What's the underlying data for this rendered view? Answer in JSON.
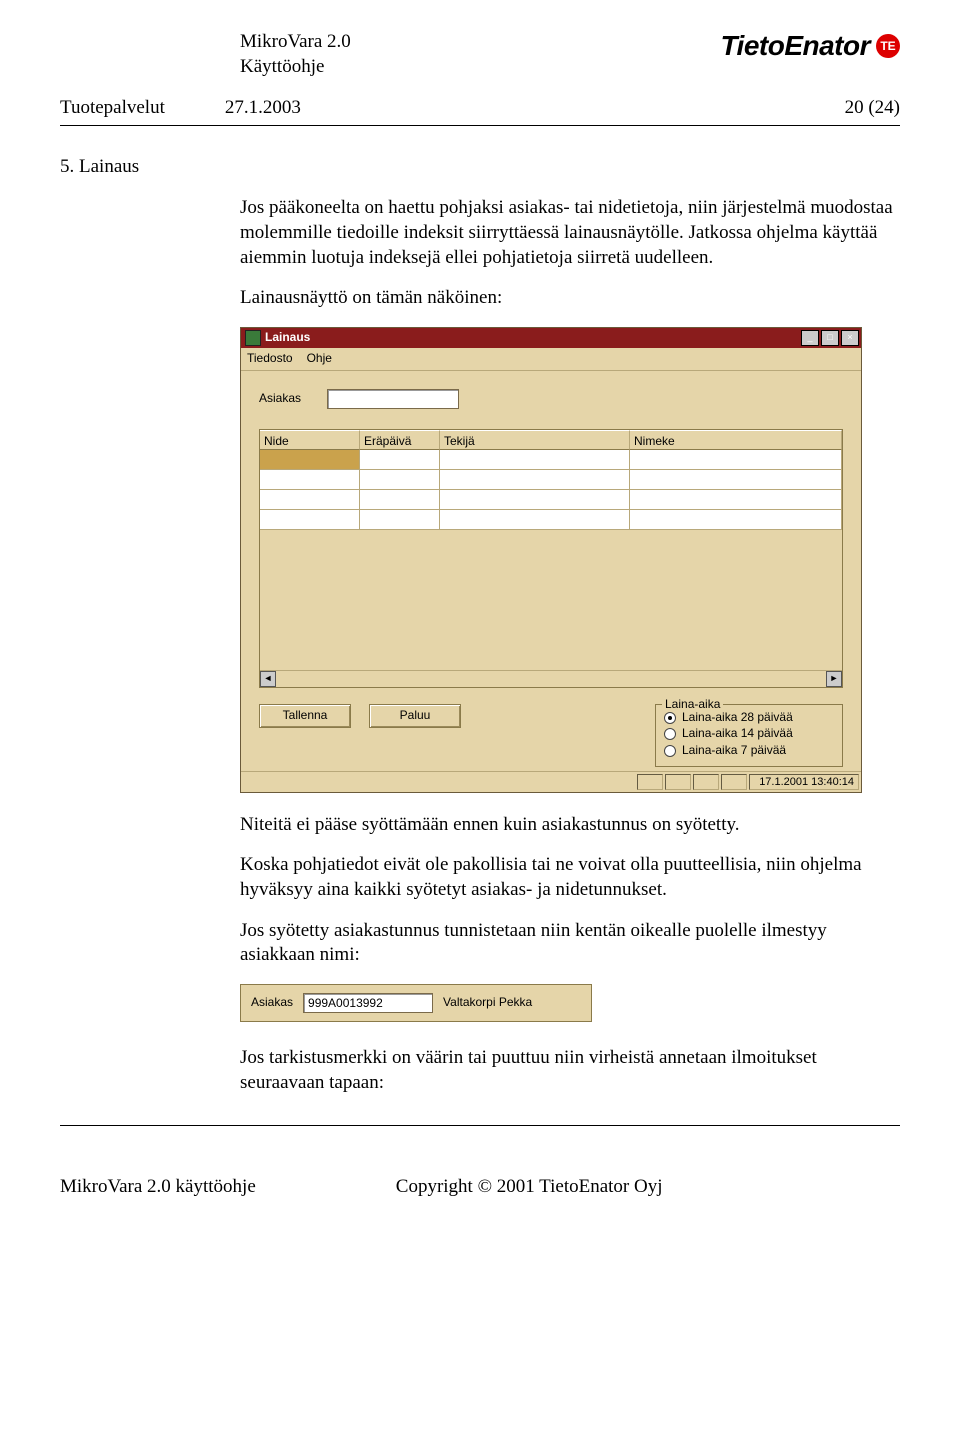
{
  "header": {
    "product": "MikroVara 2.0",
    "subtitle": "Käyttöohje",
    "company_logo_text": "TietoEnator",
    "company_logo_badge": "TE"
  },
  "meta": {
    "left": "Tuotepalvelut",
    "date": "27.1.2003",
    "page": "20 (24)"
  },
  "section": {
    "number_title": "5.  Lainaus"
  },
  "para1": "Jos pääkoneelta on haettu pohjaksi asiakas- tai nidetietoja, niin järjestelmä muodostaa molemmille tiedoille indeksit siirryttäessä lainausnäytölle. Jatkossa ohjelma käyttää aiemmin luotuja indeksejä ellei pohjatietoja siirretä uudelleen.",
  "para2": "Lainausnäyttö on tämän näköinen:",
  "para3": "Niteitä ei pääse syöttämään ennen kuin asiakastunnus on syötetty.",
  "para4": "Koska pohjatiedot eivät ole pakollisia tai ne voivat olla puutteellisia, niin ohjelma hyväksyy aina kaikki syötetyt asiakas- ja nidetunnukset.",
  "para5": "Jos syötetty asiakastunnus tunnistetaan niin kentän oikealle puolelle ilmestyy asiakkaan nimi:",
  "para6": "Jos tarkistusmerkki on väärin tai puuttuu niin virheistä annetaan ilmoitukset seuraavaan tapaan:",
  "app": {
    "title": "Lainaus",
    "menu": {
      "file": "Tiedosto",
      "help": "Ohje"
    },
    "win_ctrl": {
      "min": "_",
      "max": "□",
      "close": "×"
    },
    "field_label": "Asiakas",
    "grid": {
      "columns": [
        "Nide",
        "Eräpäivä",
        "Tekijä",
        "Nimeke"
      ]
    },
    "buttons": {
      "save": "Tallenna",
      "back": "Paluu"
    },
    "scroll": {
      "left": "◄",
      "right": "►"
    },
    "groupbox": {
      "legend": "Laina-aika",
      "options": [
        {
          "label": "Laina-aika 28 päivää",
          "selected": true
        },
        {
          "label": "Laina-aika 14 päivää",
          "selected": false
        },
        {
          "label": "Laina-aika 7 päivää",
          "selected": false
        }
      ]
    },
    "status_time": "17.1.2001 13:40:14"
  },
  "snippet": {
    "label": "Asiakas",
    "value": "999A0013992",
    "name": "Valtakorpi Pekka"
  },
  "footer": {
    "left": "MikroVara 2.0 käyttöohje",
    "right": "Copyright © 2001 TietoEnator Oyj"
  }
}
